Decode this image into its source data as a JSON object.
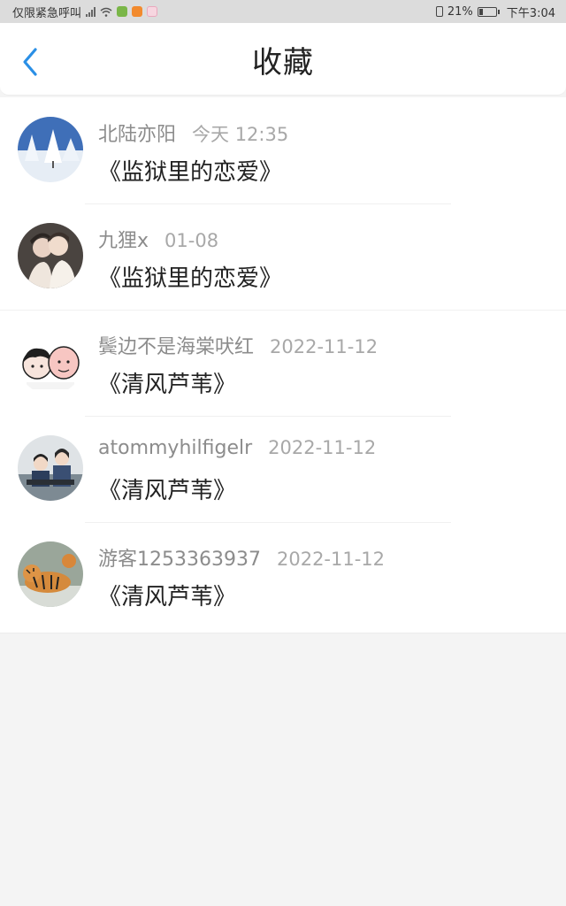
{
  "status_bar": {
    "carrier": "仅限紧急呼叫",
    "battery": "21%",
    "time": "下午3:04"
  },
  "header": {
    "title": "收藏"
  },
  "favorites": [
    {
      "user": "北陆亦阳",
      "time": "今天 12:35",
      "work": "《监狱里的恋爱》",
      "avatar": "snow-trees-avatar"
    },
    {
      "user": "九狸x",
      "time": "01-08",
      "work": "《监狱里的恋爱》",
      "avatar": "couple-avatar"
    },
    {
      "user": "鬓边不是海棠吠红",
      "time": "2022-11-12",
      "work": "《清风芦苇》",
      "avatar": "cartoon-avatar"
    },
    {
      "user": "atommyhilfigelr",
      "time": "2022-11-12",
      "work": "《清风芦苇》",
      "avatar": "kids-avatar"
    },
    {
      "user": "游客1253363937",
      "time": "2022-11-12",
      "work": "《清风芦苇》",
      "avatar": "tiger-avatar"
    }
  ]
}
